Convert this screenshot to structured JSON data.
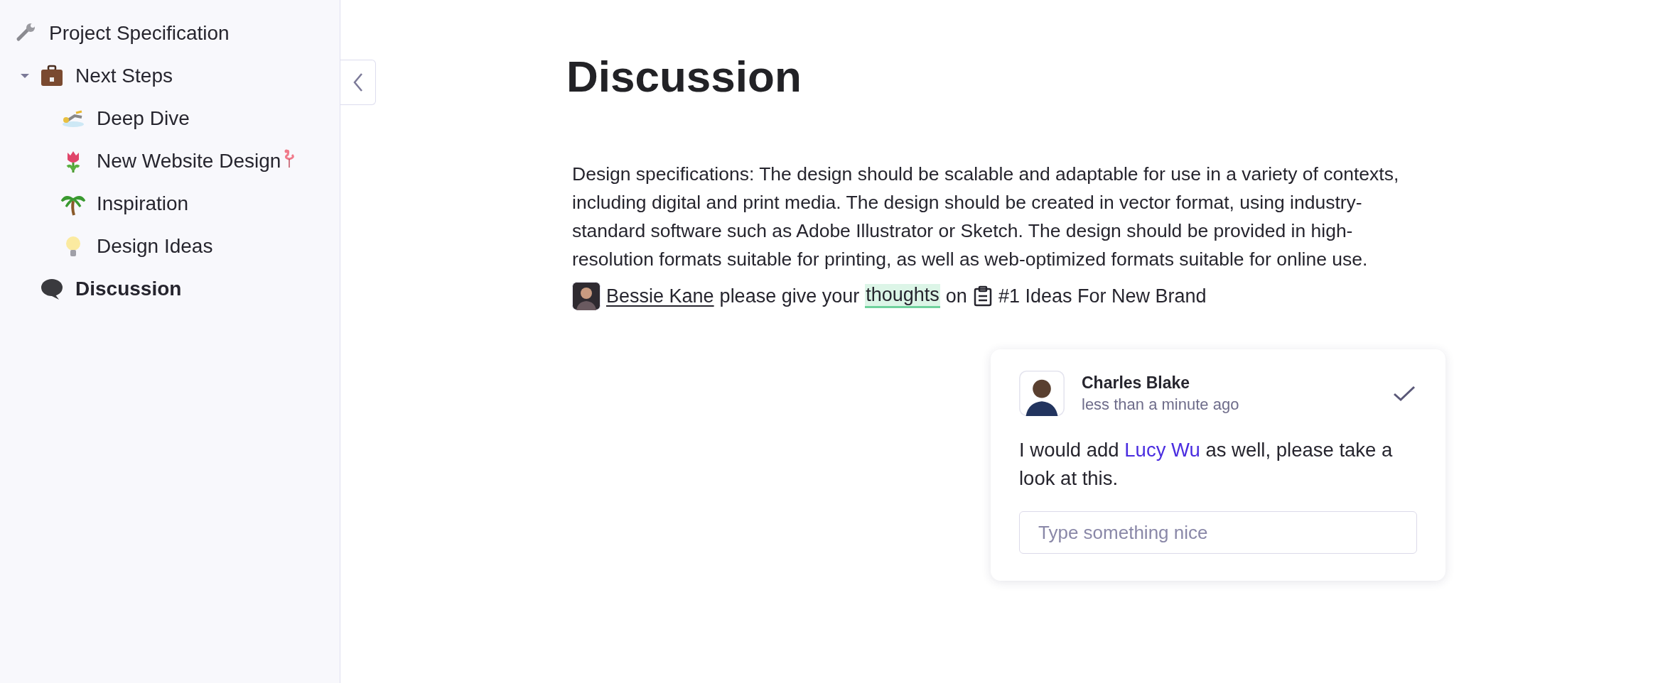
{
  "sidebar": {
    "items": [
      {
        "label": "Project Specification",
        "selected": false,
        "children": [
          {
            "label": "Next Steps",
            "selected": false,
            "expanded": true,
            "children": [
              {
                "label": "Deep Dive",
                "selected": false
              },
              {
                "label": "New Website Design",
                "selected": false
              },
              {
                "label": "Inspiration",
                "selected": false
              },
              {
                "label": "Design Ideas",
                "selected": false
              }
            ]
          },
          {
            "label": "Discussion",
            "selected": true
          }
        ]
      }
    ]
  },
  "page": {
    "title": "Discussion",
    "paragraph": "Design specifications: The design should be scalable and adaptable for use in a variety of contexts, including digital and print media. The design should be created in vector format, using industry-standard software such as Adobe Illustrator or Sketch. The design should be provided in high-resolution formats suitable for printing, as well as web-optimized formats suitable for online use.",
    "mention_line": {
      "person": "Bessie Kane",
      "text": "please give your",
      "highlight": "thoughts",
      "text_after": "on",
      "page_link": "#1 Ideas For New Brand"
    }
  },
  "comment": {
    "author": "Charles Blake",
    "time": "less than a minute ago",
    "body_before": "I would add",
    "mention": "Lucy Wu",
    "body_after": "as well, please take a look at this.",
    "reply": {
      "placeholder": "Type something nice"
    }
  }
}
